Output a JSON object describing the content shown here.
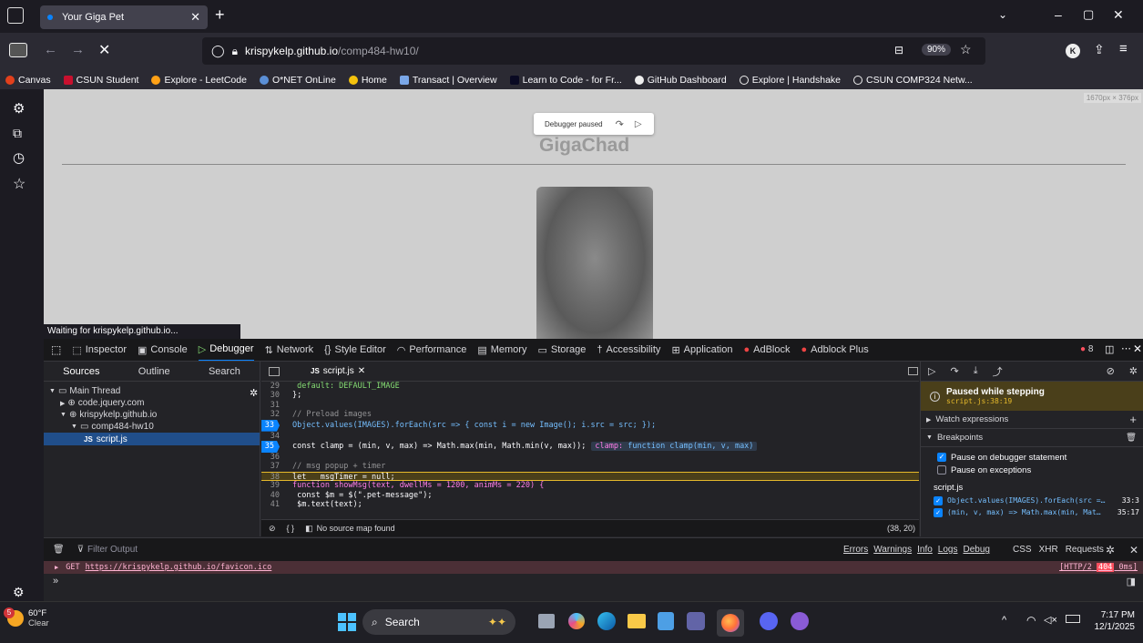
{
  "browser": {
    "tab_title": "Your Giga Pet",
    "url_domain": "krispykelp.github.io",
    "url_path": "/comp484-hw10/",
    "zoom": "90%"
  },
  "bookmarks": [
    "Canvas",
    "CSUN Student",
    "Explore - LeetCode",
    "O*NET OnLine",
    "Home",
    "Transact | Overview",
    "Learn to Code - for Fr...",
    "GitHub Dashboard",
    "Explore | Handshake",
    "CSUN COMP324 Netw..."
  ],
  "page": {
    "title": "GigaChad",
    "dims": "1670px × 376px",
    "debugger_paused": "Debugger paused",
    "status_text": "Waiting for krispykelp.github.io..."
  },
  "devtools": {
    "tabs": [
      "Inspector",
      "Console",
      "Debugger",
      "Network",
      "Style Editor",
      "Performance",
      "Memory",
      "Storage",
      "Accessibility",
      "Application",
      "AdBlock",
      "Adblock Plus"
    ],
    "error_count": "8",
    "left_tabs": [
      "Sources",
      "Outline",
      "Search"
    ],
    "tree": [
      "Main Thread",
      "code.jquery.com",
      "krispykelp.github.io",
      "comp484-hw10",
      "script.js"
    ],
    "editor_tab": "script.js",
    "code_lines": [
      {
        "n": "29",
        "t": "  default:  DEFAULT_IMAGE"
      },
      {
        "n": "30",
        "t": "};"
      },
      {
        "n": "31",
        "t": ""
      },
      {
        "n": "32",
        "t": "// Preload images"
      },
      {
        "n": "33",
        "t": "Object.values(IMAGES).forEach(src => { const i = new Image(); i.src = src; });"
      },
      {
        "n": "34",
        "t": ""
      },
      {
        "n": "35",
        "t": "const clamp = (min, v, max) => Math.max(min, Math.min(v, max));"
      },
      {
        "n": "36",
        "t": ""
      },
      {
        "n": "37",
        "t": "// msg popup + timer"
      },
      {
        "n": "38",
        "t": "let __msgTimer = null;"
      },
      {
        "n": "39",
        "t": "function showMsg(text, dwellMs = 1200, animMs = 220) {"
      },
      {
        "n": "40",
        "t": "  const $m = $(\".pet-message\");"
      },
      {
        "n": "41",
        "t": "  $m.text(text);"
      }
    ],
    "clamp_preview_label": "clamp:",
    "clamp_preview": "function clamp(min, v, max)",
    "no_source_map": "No source map found",
    "cursor_pos": "(38, 20)",
    "paused_title": "Paused while stepping",
    "paused_loc": "script.js:38:19",
    "watch_label": "Watch expressions",
    "breakpoints_label": "Breakpoints",
    "pause_debugger_stmt": "Pause on debugger statement",
    "pause_exceptions": "Pause on exceptions",
    "bp_file": "script.js",
    "bp1": "Object.values(IMAGES).forEach(src =…",
    "bp1_loc": "33:3",
    "bp2": "(min, v, max) => Math.max(min, Mat…",
    "bp2_loc": "35:17",
    "filter_placeholder": "Filter Output",
    "console_filters": [
      "Errors",
      "Warnings",
      "Info",
      "Logs",
      "Debug"
    ],
    "console_filters2": [
      "CSS",
      "XHR",
      "Requests"
    ],
    "log_method": "GET",
    "log_url": "https://krispykelp.github.io/favicon.ico",
    "log_status_pre": "[HTTP/2",
    "log_status_code": "404",
    "log_status_post": "0ms]",
    "prompt": "»"
  },
  "taskbar": {
    "weather_temp": "60°F",
    "weather_desc": "Clear",
    "search_label": "Search",
    "time": "7:17 PM",
    "date": "12/1/2025",
    "notif_count": "5"
  },
  "colors": {
    "accent": "#0a84ff",
    "pause_bg": "#4a3f1a",
    "error": "#ff4f5e"
  }
}
